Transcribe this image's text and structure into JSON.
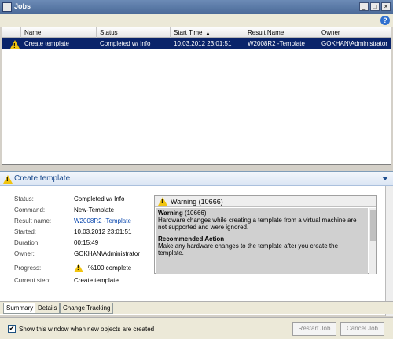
{
  "window": {
    "title": "Jobs",
    "minimize_glyph": "_",
    "maximize_glyph": "□",
    "close_glyph": "×",
    "help_glyph": "?"
  },
  "grid": {
    "columns": [
      "Name",
      "Status",
      "Start Time",
      "Result Name",
      "Owner"
    ],
    "sort_indicator": "▲",
    "rows": [
      {
        "name": "Create template",
        "status": "Completed w/ Info",
        "start_time": "10.03.2012 23:01:51",
        "result_name": "W2008R2 -Template",
        "owner": "GOKHAN\\Administrator"
      }
    ]
  },
  "details": {
    "header_title": "Create template",
    "properties": [
      {
        "label": "Status:",
        "value": "Completed w/ Info"
      },
      {
        "label": "Command:",
        "value": "New-Template"
      },
      {
        "label": "Result name:",
        "value": "W2008R2 -Template"
      },
      {
        "label": "Started:",
        "value": "10.03.2012 23:01:51"
      },
      {
        "label": "Duration:",
        "value": "00:15:49"
      },
      {
        "label": "Owner:",
        "value": "GOKHAN\\Administrator"
      },
      {
        "label": "Progress:",
        "value": "%100 complete"
      },
      {
        "label": "Current step:",
        "value": "Create template"
      }
    ],
    "message": {
      "title": "Warning (10666)",
      "heading": "Warning",
      "code": "(10666)",
      "text": "Hardware changes while creating a template from a virtual machine are not supported and were ignored.",
      "action_heading": "Recommended Action",
      "action_text": "Make any hardware changes to the template after you create the template."
    }
  },
  "tabs": [
    "Summary",
    "Details",
    "Change Tracking"
  ],
  "footer": {
    "checkbox_label": "Show this window when new objects are created",
    "checkbox_checked": true,
    "checkbox_glyph": "✔",
    "restart_button": "Restart Job",
    "cancel_button": "Cancel Job"
  },
  "colors": {
    "selection": "#0a246a",
    "warning": "#f1c40f",
    "link": "#0645ad"
  }
}
